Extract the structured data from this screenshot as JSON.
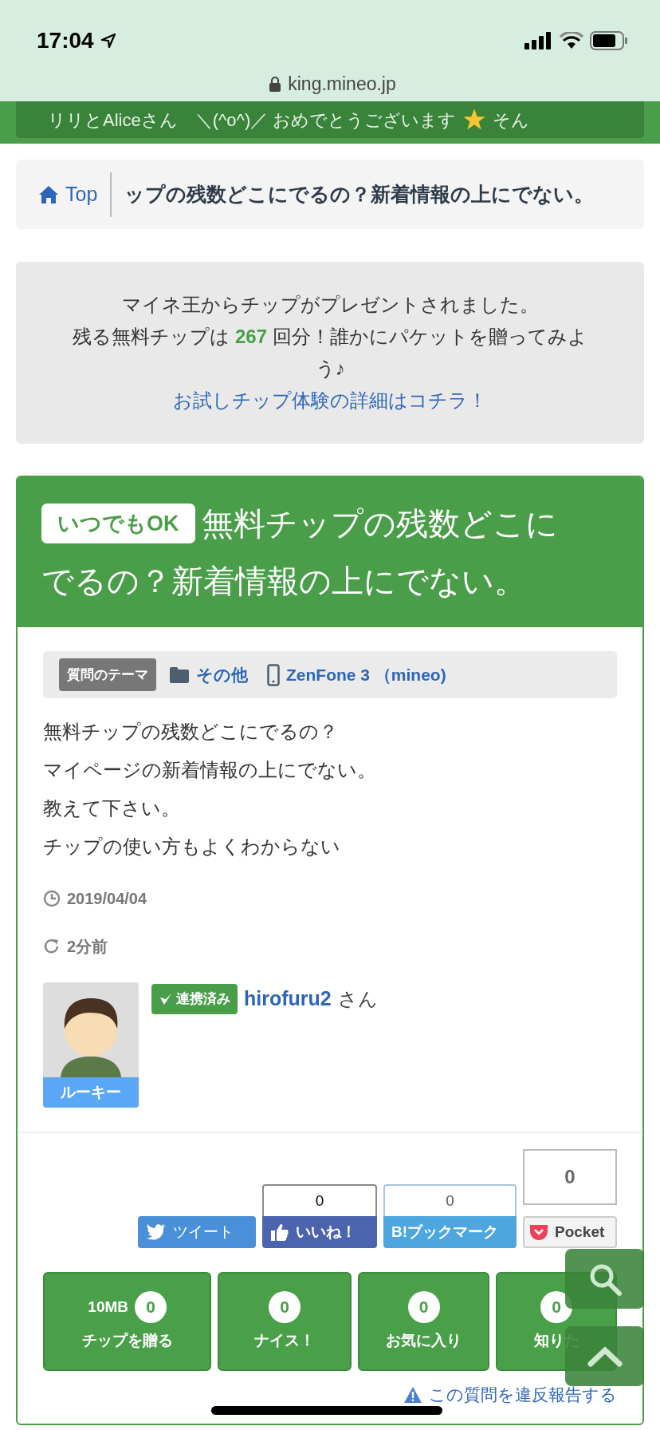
{
  "status_bar": {
    "time": "17:04",
    "url": "king.mineo.jp"
  },
  "ticker": {
    "text": "リリとAliceさん　＼(^o^)／ おめでとうございます",
    "text_after": "そん"
  },
  "breadcrumb": {
    "home": "Top",
    "current": "ップの残数どこにでるの？新着情報の上にでない。"
  },
  "notice": {
    "lines": [
      "マイネ王からチップがプレゼントされました。",
      "残る無料チップは **267** 回分！誰かにパケットを贈ってみよう♪"
    ],
    "link": "お試しチップ体験の詳細はコチラ！"
  },
  "question": {
    "badge": "いつでもOK",
    "title_lines": [
      "無料チップの残数どこに",
      "でるの？新着情報の上にでない。"
    ],
    "theme_label": "質問のテーマ",
    "category": "その他",
    "device": "ZenFone 3 （mineo)",
    "body": [
      "無料チップの残数どこにでるの？",
      "マイページの新着情報の上にでない。",
      "教えて下さい。",
      "チップの使い方もよくわからない"
    ],
    "posted": "2019/04/04",
    "updated": "2分前",
    "user": {
      "rank": "ルーキー",
      "linked_badge": "連携済み",
      "name": "hirofuru2",
      "honorific": "さん"
    }
  },
  "social": [
    {
      "kind": "twitter",
      "label": "ツイート"
    },
    {
      "kind": "facebook",
      "label": "いいね！",
      "count": "0"
    },
    {
      "kind": "hatena",
      "logo": "B!",
      "label": "ブックマーク",
      "count": "0"
    },
    {
      "kind": "pocket",
      "label": "Pocket",
      "count": "0"
    }
  ],
  "actions": [
    {
      "prefix": "10MB",
      "count": "0",
      "label": "チップを贈る"
    },
    {
      "count": "0",
      "label": "ナイス！"
    },
    {
      "count": "0",
      "label": "お気に入り"
    },
    {
      "count": "0",
      "label": "知りた"
    }
  ],
  "report": "この質問を違反報告する"
}
